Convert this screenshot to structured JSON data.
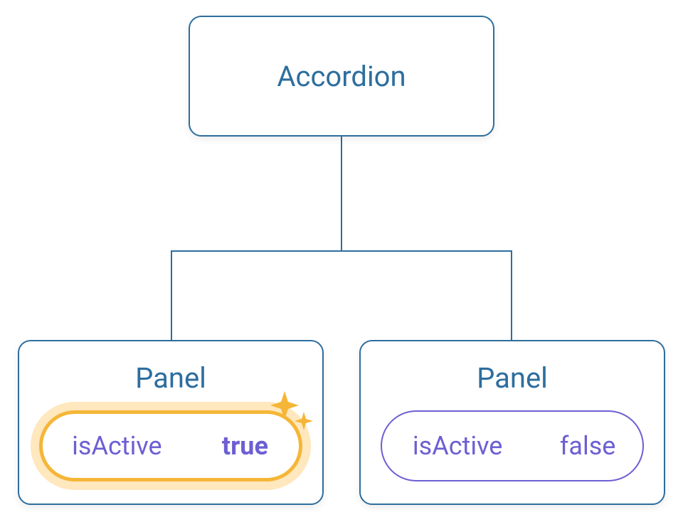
{
  "diagram": {
    "root": {
      "label": "Accordion"
    },
    "children": [
      {
        "label": "Panel",
        "state": {
          "key": "isActive",
          "value": "true"
        },
        "active": true
      },
      {
        "label": "Panel",
        "state": {
          "key": "isActive",
          "value": "false"
        },
        "active": false
      }
    ]
  },
  "colors": {
    "border": "#2d6e9e",
    "text": "#2d6e9e",
    "state": "#6c5fd3",
    "highlight": "#f5b637"
  }
}
